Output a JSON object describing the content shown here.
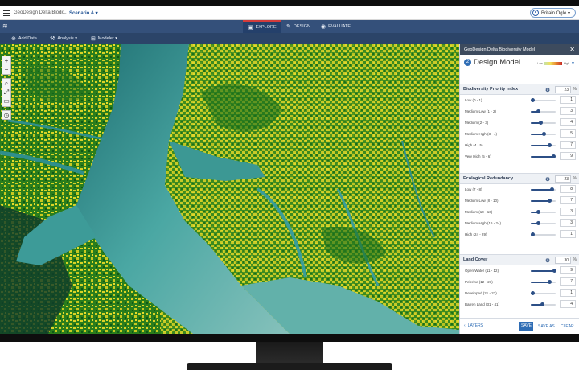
{
  "app": {
    "name": "GeoDesign Delta Biodi...",
    "separator": "/",
    "scenario": "Scenario A ▾",
    "user": "Britain Ogle ▾"
  },
  "modes": [
    {
      "label": "EXPLORE",
      "icon": "map-icon",
      "active": true
    },
    {
      "label": "DESIGN",
      "icon": "pencil-icon",
      "active": false
    },
    {
      "label": "EVALUATE",
      "icon": "eye-icon",
      "active": false
    }
  ],
  "tools": [
    {
      "label": "Add Data",
      "icon": "plus-circle-icon"
    },
    {
      "label": "Analysis ▾",
      "icon": "analysis-icon"
    },
    {
      "label": "Modeler ▾",
      "icon": "modeler-icon"
    }
  ],
  "map_controls": [
    "+",
    "−",
    "⌕",
    "⤢",
    "▭",
    "◷"
  ],
  "panel": {
    "header": "GeoDesign Delta Biodiversity Model",
    "close": "✕",
    "step": "2",
    "title": "Design Model",
    "legend_low": "Low",
    "legend_high": "High",
    "sections": [
      {
        "title": "Biodiversity Priority Index",
        "weight": "23",
        "rows": [
          {
            "label": "Low (0 - 1)",
            "value": "1",
            "level": 0.05
          },
          {
            "label": "Medium-Low (1 - 2)",
            "value": "3",
            "level": 0.3
          },
          {
            "label": "Medium (2 - 3)",
            "value": "4",
            "level": 0.4
          },
          {
            "label": "Medium-High (3 - 4)",
            "value": "5",
            "level": 0.5
          },
          {
            "label": "High (4 - 5)",
            "value": "7",
            "level": 0.75
          },
          {
            "label": "Very High (5 - 6)",
            "value": "9",
            "level": 0.9
          }
        ]
      },
      {
        "title": "Ecological Redundancy",
        "weight": "23",
        "rows": [
          {
            "label": "Low (7 - 8)",
            "value": "8",
            "level": 0.85
          },
          {
            "label": "Medium-Low (8 - 10)",
            "value": "7",
            "level": 0.75
          },
          {
            "label": "Medium (10 - 16)",
            "value": "3",
            "level": 0.3
          },
          {
            "label": "Medium-High (16 - 24)",
            "value": "3",
            "level": 0.3
          },
          {
            "label": "High (24 - 29)",
            "value": "1",
            "level": 0.05
          }
        ]
      },
      {
        "title": "Land Cover",
        "weight": "30",
        "rows": [
          {
            "label": "Open Water (11 - 12)",
            "value": "9",
            "level": 0.95
          },
          {
            "label": "Pelerine (12 - 21)",
            "value": "7",
            "level": 0.75
          },
          {
            "label": "Developed (21 - 23)",
            "value": "1",
            "level": 0.05
          },
          {
            "label": "Barren Land (31 - 41)",
            "value": "4",
            "level": 0.45
          }
        ]
      }
    ],
    "pct": "%",
    "footer": {
      "layers": "LAYERS",
      "save": "SAVE",
      "save_as": "SAVE AS",
      "clear": "CLEAR"
    }
  },
  "colors": {
    "accent": "#2f6db5",
    "topnav": "#34507a",
    "toolbar": "#2b4468",
    "map_land": "#1f6b1f",
    "map_highlight": "#e0d321",
    "map_water": "#3f9e9c"
  }
}
